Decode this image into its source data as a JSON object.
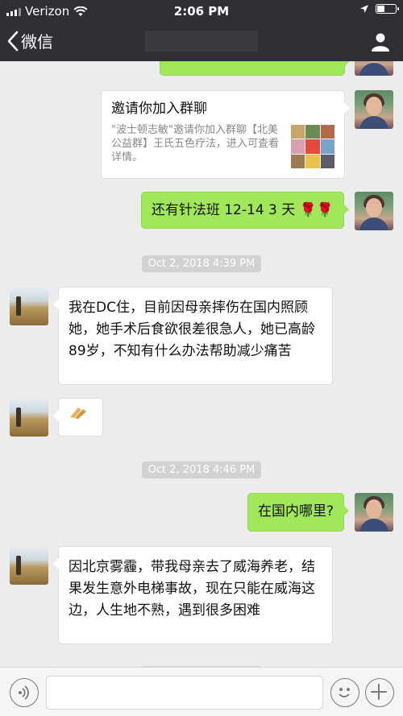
{
  "status_bar": {
    "carrier": "Verizon",
    "time": "2:06 PM"
  },
  "nav": {
    "back_label": "微信"
  },
  "messages": {
    "invite": {
      "title": "邀请你加入群聊",
      "desc": "\"波士顿志敏\"邀请你加入群聊【北美公益群】王氏五色疗法，进入可查看详情。"
    },
    "acupuncture": "还有针法班 12-14 3 天 🌹🌹",
    "ts1": "Oct 2, 2018 4:39 PM",
    "dc": "我在DC住，目前因母亲摔伤在国内照顾她，她手术后食欲很差很急人，她已高龄89岁，不知有什么办法帮助减少痛苦",
    "ts2": "Oct 2, 2018 4:46 PM",
    "where": "在国内哪里?",
    "weihai": "因北京雾霾，带我母亲去了威海养老，结果发生意外电梯事故，现在只能在威海这边，人生地不熟，遇到很多困难"
  },
  "colors": {
    "green_bubble": "#a0e75a",
    "nav_bg": "#2f2f35",
    "chat_bg": "#ececec"
  }
}
